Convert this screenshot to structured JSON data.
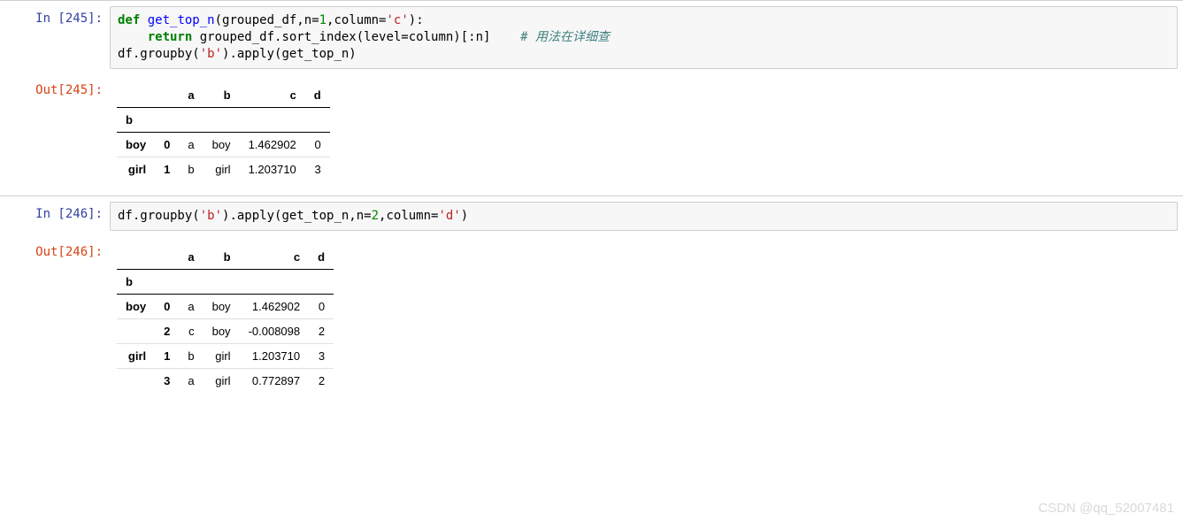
{
  "cells": [
    {
      "in_prompt": "In  [245]:",
      "out_prompt": "Out[245]:",
      "code": {
        "l1_def": "def",
        "l1_fn": " get_top_n",
        "l1_rest1": "(grouped_df,n=",
        "l1_n": "1",
        "l1_rest2": ",column=",
        "l1_str": "'c'",
        "l1_rest3": "):",
        "l2_indent": "    ",
        "l2_return": "return",
        "l2_rest": " grouped_df.sort_index(level=column)[:n]    ",
        "l2_comment": "# 用法在详细查",
        "l3": "df.groupby(",
        "l3_str": "'b'",
        "l3_rest": ").apply(get_top_n)"
      },
      "table": {
        "col_headers": [
          "",
          "",
          "a",
          "b",
          "c",
          "d"
        ],
        "sub_header": [
          "b",
          "",
          "",
          "",
          "",
          ""
        ],
        "rows": [
          {
            "idx": [
              "boy",
              "0"
            ],
            "vals": [
              "a",
              "boy",
              "1.462902",
              "0"
            ]
          },
          {
            "idx": [
              "girl",
              "1"
            ],
            "vals": [
              "b",
              "girl",
              "1.203710",
              "3"
            ]
          }
        ]
      }
    },
    {
      "in_prompt": "In  [246]:",
      "out_prompt": "Out[246]:",
      "code": {
        "l1a": "df.groupby(",
        "l1a_str": "'b'",
        "l1b": ").apply(get_top_n,n=",
        "l1b_n": "2",
        "l1c": ",column=",
        "l1c_str": "'d'",
        "l1d": ")"
      },
      "table": {
        "col_headers": [
          "",
          "",
          "a",
          "b",
          "c",
          "d"
        ],
        "sub_header": [
          "b",
          "",
          "",
          "",
          "",
          ""
        ],
        "rows": [
          {
            "idx": [
              "boy",
              "0"
            ],
            "vals": [
              "a",
              "boy",
              "1.462902",
              "0"
            ]
          },
          {
            "idx": [
              "",
              "2"
            ],
            "vals": [
              "c",
              "boy",
              "-0.008098",
              "2"
            ]
          },
          {
            "idx": [
              "girl",
              "1"
            ],
            "vals": [
              "b",
              "girl",
              "1.203710",
              "3"
            ]
          },
          {
            "idx": [
              "",
              "3"
            ],
            "vals": [
              "a",
              "girl",
              "0.772897",
              "2"
            ]
          }
        ]
      }
    }
  ],
  "watermark": "CSDN @qq_52007481"
}
